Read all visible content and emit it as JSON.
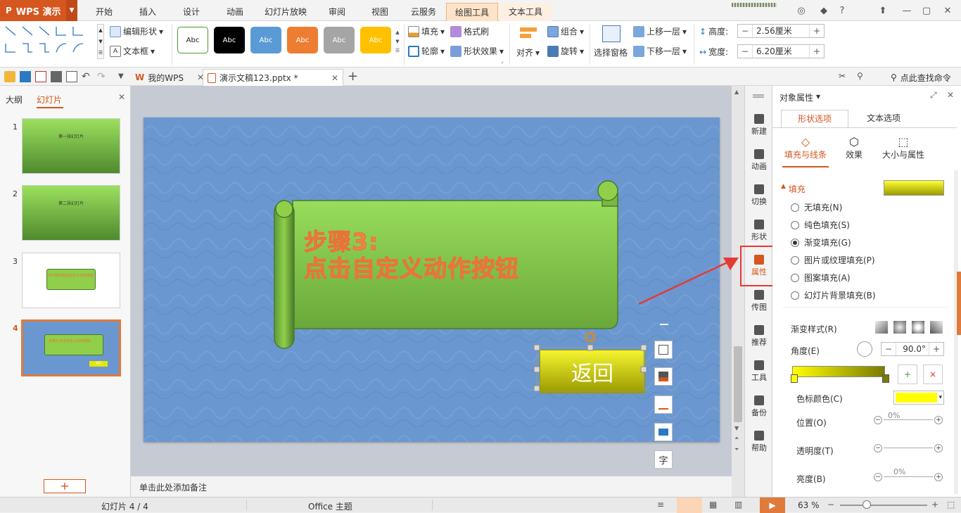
{
  "app": {
    "name": "WPS 演示"
  },
  "tabs": [
    "开始",
    "插入",
    "设计",
    "动画",
    "幻灯片放映",
    "审阅",
    "视图",
    "云服务",
    "绘图工具",
    "文本工具"
  ],
  "ribbon": {
    "edit_shape": "编辑形状",
    "textbox": "文本框",
    "style_label": "Abc",
    "fill": "填充",
    "format_painter": "格式刷",
    "outline": "轮廓",
    "shape_effect": "形状效果",
    "align": "对齐",
    "group": "组合",
    "rotate": "旋转",
    "selection_pane": "选择窗格",
    "bring_forward": "上移一层",
    "send_backward": "下移一层",
    "height_label": "高度:",
    "height_value": "2.56厘米",
    "width_label": "宽度:",
    "width_value": "6.20厘米"
  },
  "docbar": {
    "my_wps": "我的WPS",
    "doc_name": "演示文稿123.pptx *",
    "search": "点此查找命令"
  },
  "leftpanel": {
    "tab_outline": "大纲",
    "tab_slides": "幻灯片",
    "slides": [
      {
        "num": "1",
        "text": "第一张幻灯片"
      },
      {
        "num": "2",
        "text": "第二张幻灯片"
      },
      {
        "num": "3",
        "text": "PPT如何添加自定义动作按钮"
      },
      {
        "num": "4",
        "text": "步骤3:点击自定义动作按钮",
        "button": "返回"
      }
    ]
  },
  "slide": {
    "title_line1": "步骤3:",
    "title_line2": "点击自定义动作按钮",
    "button_text": "返回"
  },
  "notes": "单击此处添加备注",
  "siderail": [
    "新建",
    "动画",
    "切换",
    "形状",
    "属性",
    "传图",
    "推荐",
    "工具",
    "备份",
    "帮助"
  ],
  "props": {
    "panel_title": "对象属性",
    "tab_shape": "形状选项",
    "tab_text": "文本选项",
    "sub_fill": "填充与线条",
    "sub_effect": "效果",
    "sub_size": "大小与属性",
    "fill_section": "填充",
    "options": [
      "无填充(N)",
      "纯色填充(S)",
      "渐变填充(G)",
      "图片或纹理填充(P)",
      "图案填充(A)",
      "幻灯片背景填充(B)"
    ],
    "selected": 2,
    "gradient_style": "渐变样式(R)",
    "angle_label": "角度(E)",
    "angle_value": "90.0°",
    "stop_color": "色标颜色(C)",
    "position": "位置(O)",
    "position_value": "0%",
    "transparency": "透明度(T)",
    "brightness": "亮度(B)",
    "brightness_value": "0%"
  },
  "status": {
    "slide_info": "幻灯片 4 / 4",
    "theme": "Office 主题",
    "zoom": "63 %"
  },
  "colors": {
    "accent": "#d5561f",
    "slide_bg": "#6a97cf",
    "scroll_green": "#8fcf4a",
    "button_yellow": "#e6e600",
    "annotation_red": "#e53935"
  }
}
